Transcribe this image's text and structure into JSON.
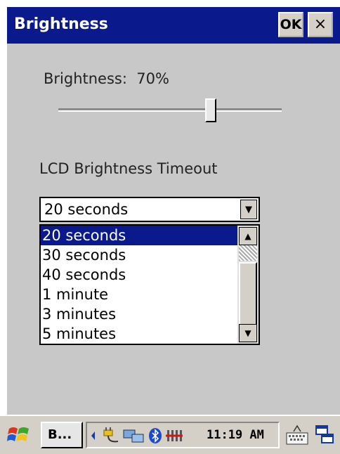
{
  "window": {
    "title": "Brightness",
    "ok_label": "OK",
    "close_label": "×"
  },
  "brightness": {
    "label": "Brightness:",
    "value": "70%",
    "level": 0.7
  },
  "timeout": {
    "label": "LCD Brightness Timeout",
    "selected": "20 seconds",
    "options": [
      "20 seconds",
      "30 seconds",
      "40 seconds",
      "1 minute",
      "3 minutes",
      "5 minutes"
    ]
  },
  "taskbar": {
    "task_button_label": "B...",
    "time": "11:19 AM",
    "icons": [
      "windows-start-icon",
      "tray-arrow-icon",
      "power-plug-icon",
      "network-icon",
      "bluetooth-icon",
      "signal-icon",
      "keyboard-icon",
      "desktop-icon"
    ]
  },
  "colors": {
    "titlebar": "#0a1a8c",
    "window_bg": "#c8c8c8",
    "selection": "#0a1a8c"
  }
}
